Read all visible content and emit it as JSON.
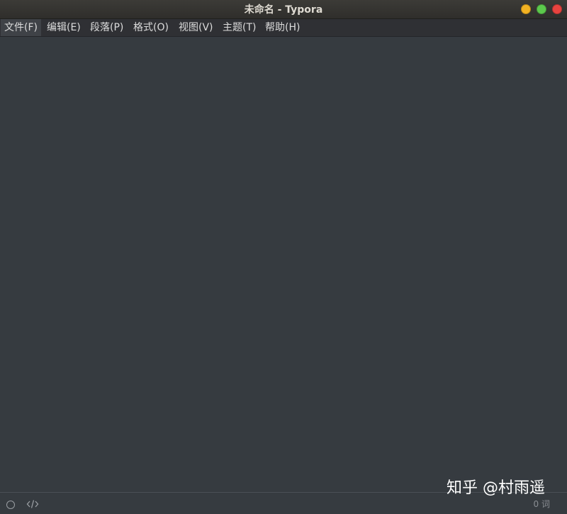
{
  "window": {
    "title": "未命名 - Typora"
  },
  "menu": {
    "items": [
      {
        "label": "文件(F)"
      },
      {
        "label": "编辑(E)"
      },
      {
        "label": "段落(P)"
      },
      {
        "label": "格式(O)"
      },
      {
        "label": "视图(V)"
      },
      {
        "label": "主题(T)"
      },
      {
        "label": "帮助(H)"
      }
    ]
  },
  "statusbar": {
    "word_count": "0 词"
  },
  "watermark": {
    "text": "知乎 @村雨遥"
  },
  "colors": {
    "editor_bg": "#363b40",
    "minimize": "#f2b222",
    "maximize": "#5cc94c",
    "close": "#e9433f"
  }
}
